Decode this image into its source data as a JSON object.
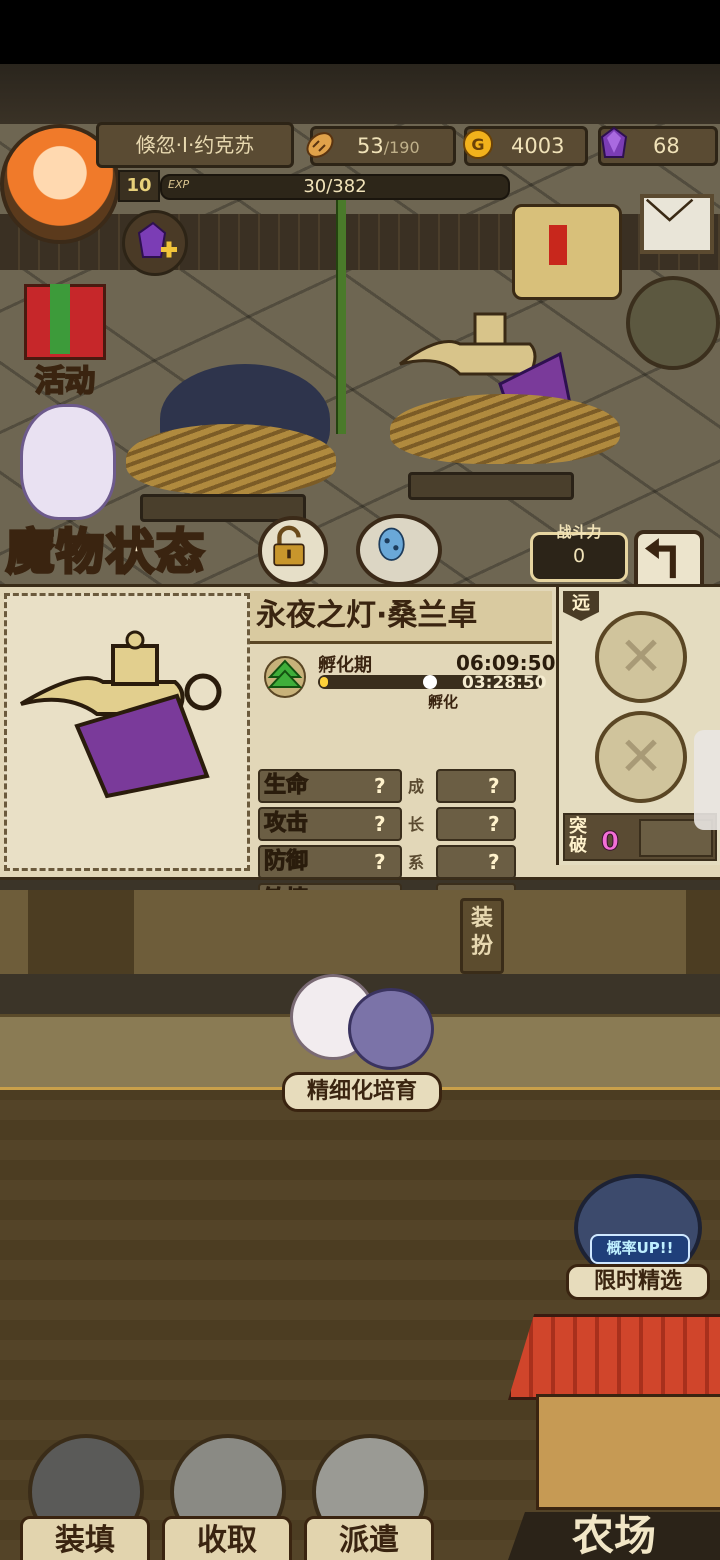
{
  "header": {
    "player_name": "倏忽·I·约克苏",
    "level": "10",
    "exp_label": "EXP",
    "exp_value": "30/382",
    "stamina_current": "53",
    "stamina_max": "/190",
    "gold": "4003",
    "gems": "68"
  },
  "side": {
    "activity_label": "活动"
  },
  "monster_status": {
    "title": "魔物状态",
    "power_label": "战斗力",
    "power_value": "0",
    "name": "永夜之灯·桑兰卓",
    "stage_label": "孵化期",
    "timer_total": "06:09:50",
    "timer_remaining": "03:28:50",
    "hatch_label": "孵化",
    "hatch_progress": 0.5,
    "stats": [
      {
        "name": "生命",
        "value": "?",
        "growth": "?"
      },
      {
        "name": "攻击",
        "value": "?",
        "growth": "?"
      },
      {
        "name": "防御",
        "value": "?",
        "growth": "?"
      },
      {
        "name": "敏捷",
        "value": "?",
        "growth": "?"
      }
    ],
    "growth_chars": [
      "成",
      "长",
      "系",
      "数"
    ],
    "range_tag": "远",
    "break_label": "突破",
    "break_value": "0"
  },
  "lower": {
    "equip_label": "装扮",
    "fine_train_label": "精细化培育",
    "rate_up_label": "概率UP!!",
    "limited_label": "限时精选",
    "farm_label": "农场",
    "bottom_buttons": [
      "装填",
      "收取",
      "派遣"
    ]
  },
  "colors": {
    "panel_bg": "#e2d7b8",
    "text_dark": "#3a2410",
    "break_pink": "#f36fd6",
    "progress_yellow": "#ffd33a"
  },
  "icons": [
    "gold-coin-icon",
    "gem-icon",
    "bread-icon",
    "mail-icon",
    "lock-icon",
    "back-arrow-icon",
    "gift-icon",
    "growth-arrow-icon",
    "empty-slot-icon"
  ]
}
